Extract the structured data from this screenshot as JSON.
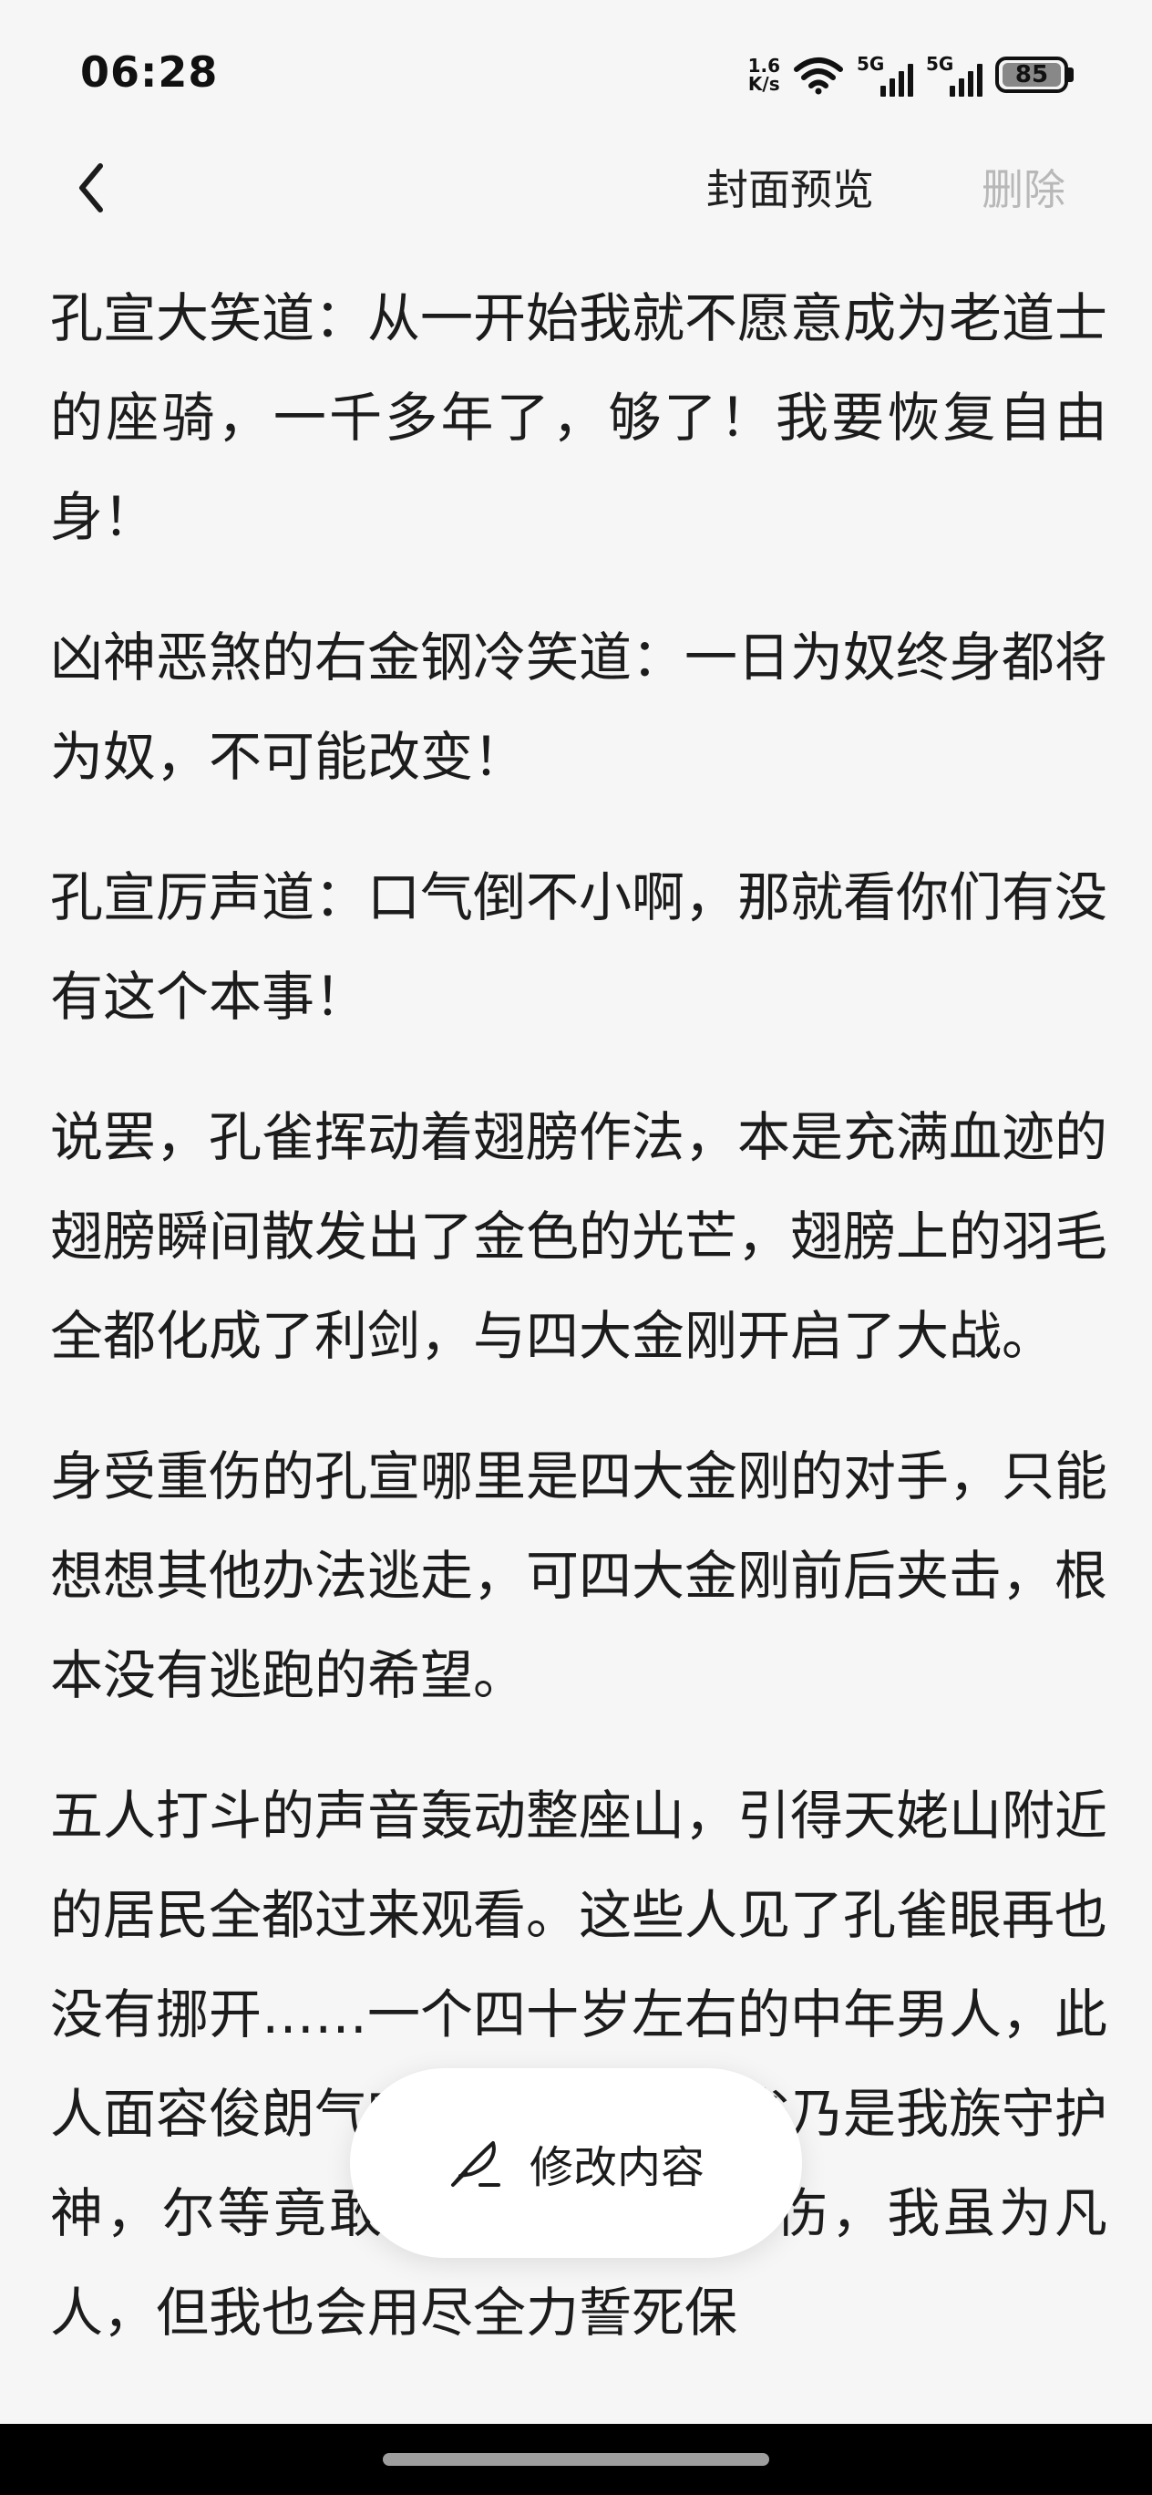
{
  "status_bar": {
    "time": "06:28",
    "net_speed_value": "1.6",
    "net_speed_unit": "K/s",
    "sim1_tag": "5G",
    "sim2_tag": "5G",
    "battery_level": "85"
  },
  "top_bar": {
    "cover_preview_label": "封面预览",
    "delete_label": "删除"
  },
  "content": {
    "paragraphs": [
      "孔宣大笑道：从一开始我就不愿意成为老道士的座骑，一千多年了，够了！我要恢复自由身！",
      "凶神恶煞的右金钢冷笑道：一日为奴终身都将为奴，不可能改变！",
      "孔宣厉声道：口气倒不小啊，那就看你们有没有这个本事！",
      "说罢，孔雀挥动着翅膀作法，本是充满血迹的翅膀瞬间散发出了金色的光芒，翅膀上的羽毛全都化成了利剑，与四大金刚开启了大战。",
      "身受重伤的孔宣哪里是四大金刚的对手，只能想想其他办法逃走，可四大金刚前后夹击，根本没有逃跑的希望。",
      "五人打斗的声音轰动整座山，引得天姥山附近的居民全都过来观看。这些人见了孔雀眼再也没有挪开……一个四十岁左右的中年男人，此人面容俊朗气宇不凡，道：孔雀乃是我族守护神，尔等竟敢将它打的遍体鳞伤，我虽为凡人，但我也会用尽全力誓死保"
    ]
  },
  "edit_button": {
    "label": "修改内容",
    "icon": "feather-pen-icon"
  }
}
